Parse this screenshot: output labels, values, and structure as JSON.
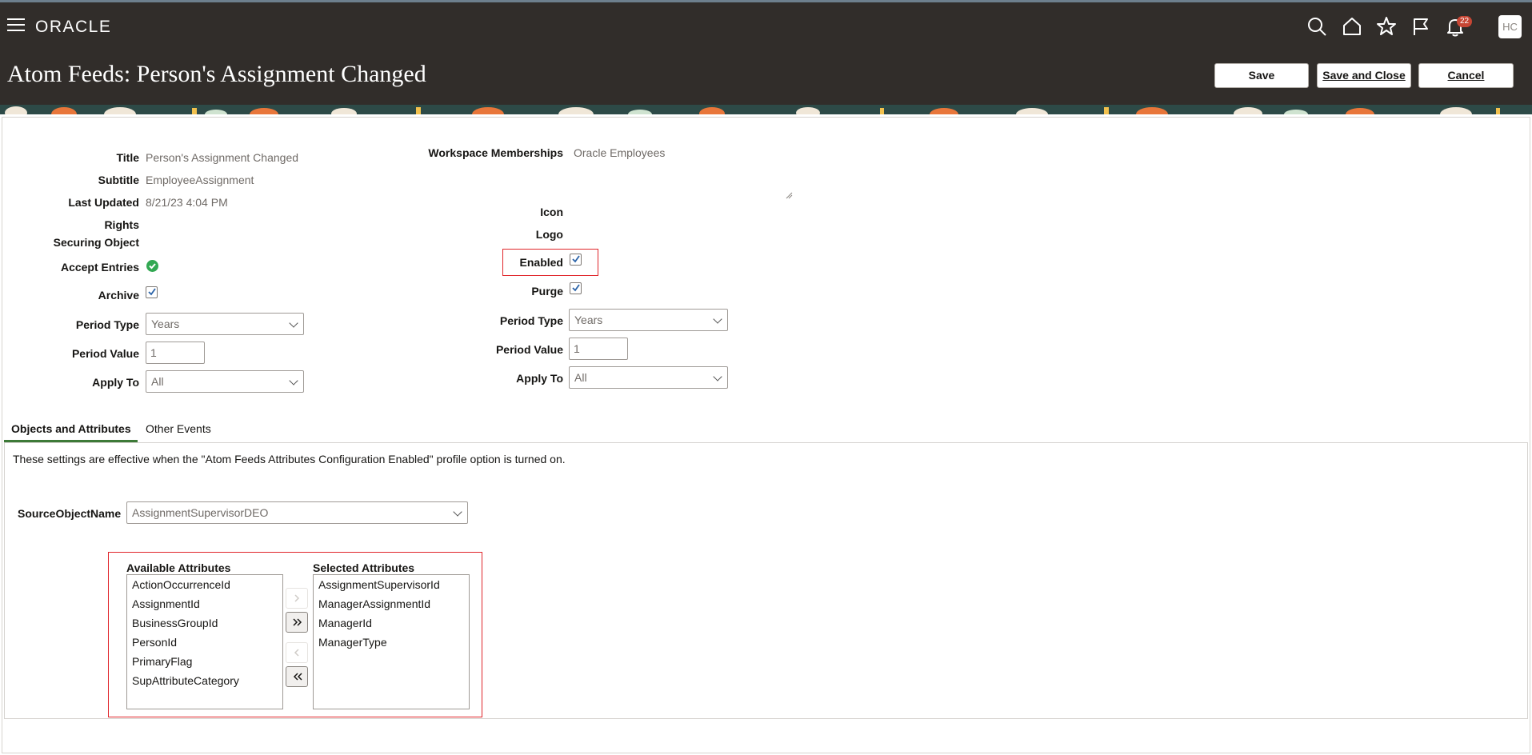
{
  "app": {
    "logo": "ORACLE",
    "notification_count": "22",
    "user_initials": "HC"
  },
  "header": {
    "title": "Atom Feeds: Person's Assignment Changed",
    "save_label": "Save",
    "save_close_label": "Save and Close",
    "cancel_label": "Cancel"
  },
  "icons": {
    "menu": "hamburger-icon",
    "search": "search-icon",
    "home": "home-icon",
    "favorites": "star-icon",
    "watchlist": "flag-icon",
    "notifications": "bell-icon"
  },
  "form": {
    "title_label": "Title",
    "title_value": "Person's Assignment Changed",
    "subtitle_label": "Subtitle",
    "subtitle_value": "EmployeeAssignment",
    "last_updated_label": "Last Updated",
    "last_updated_value": "8/21/23 4:04 PM",
    "rights_label": "Rights",
    "securing_object_label": "Securing Object",
    "accept_entries_label": "Accept Entries",
    "archive_label": "Archive",
    "archive_checked": true,
    "left_period_type_label": "Period Type",
    "left_period_type_value": "Years",
    "left_period_value_label": "Period Value",
    "left_period_value_value": "1",
    "left_apply_to_label": "Apply To",
    "left_apply_to_value": "All",
    "workspace_label": "Workspace Memberships",
    "workspace_value": "Oracle Employees",
    "icon_label": "Icon",
    "logo_label": "Logo",
    "enabled_label": "Enabled",
    "enabled_checked": true,
    "purge_label": "Purge",
    "purge_checked": true,
    "right_period_type_label": "Period Type",
    "right_period_type_value": "Years",
    "right_period_value_label": "Period Value",
    "right_period_value_value": "1",
    "right_apply_to_label": "Apply To",
    "right_apply_to_value": "All"
  },
  "tabs": [
    {
      "label": "Objects and Attributes",
      "active": true
    },
    {
      "label": "Other Events",
      "active": false
    }
  ],
  "panel": {
    "note": "These settings are effective when the \"Atom Feeds Attributes Configuration Enabled\" profile option is turned on.",
    "source_object_label": "SourceObjectName",
    "source_object_value": "AssignmentSupervisorDEO",
    "available_title": "Available Attributes",
    "available": [
      "ActionOccurrenceId",
      "AssignmentId",
      "BusinessGroupId",
      "PersonId",
      "PrimaryFlag",
      "SupAttributeCategory"
    ],
    "selected_title": "Selected Attributes",
    "selected": [
      "AssignmentSupervisorId",
      "ManagerAssignmentId",
      "ManagerId",
      "ManagerType"
    ]
  },
  "colors": {
    "header_bg": "#312d2a",
    "accent_green": "#3d7a38",
    "highlight_red": "#e0252a",
    "badge_red": "#c74634"
  }
}
